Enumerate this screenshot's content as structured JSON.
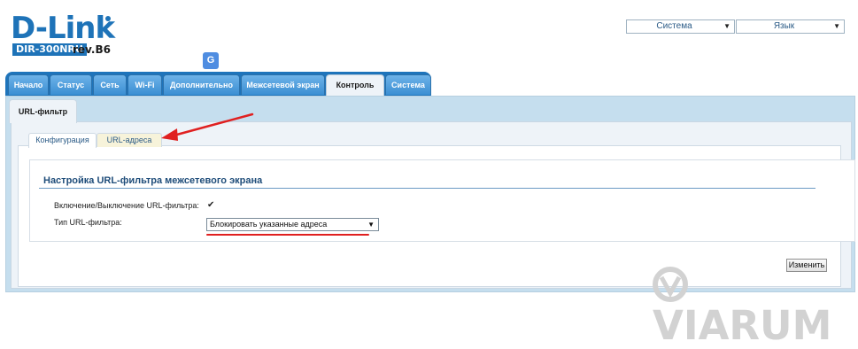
{
  "brand": {
    "logo": "D-Link",
    "model": "DIR-300NRU",
    "revision": "rev.B6"
  },
  "top_menu": {
    "system": "Система",
    "language": "Язык"
  },
  "tabs": [
    "Начало",
    "Статус",
    "Сеть",
    "Wi-Fi",
    "Дополнительно",
    "Межсетевой экран",
    "Контроль",
    "Система"
  ],
  "active_tab": "Контроль",
  "sub_tab": "URL-фильтр",
  "inner_tabs": [
    "Конфигурация",
    "URL-адреса"
  ],
  "section": {
    "title": "Настройка URL-фильтра межсетевого экрана",
    "enable_label": "Включение/Выключение URL-фильтра:",
    "enable_checked": true,
    "type_label": "Тип URL-фильтра:",
    "type_value": "Блокировать указанные адреса"
  },
  "apply_label": "Изменить",
  "watermark": "VIARUM",
  "colors": {
    "brand_blue": "#1e73b8",
    "annotation_red": "#e02020"
  }
}
